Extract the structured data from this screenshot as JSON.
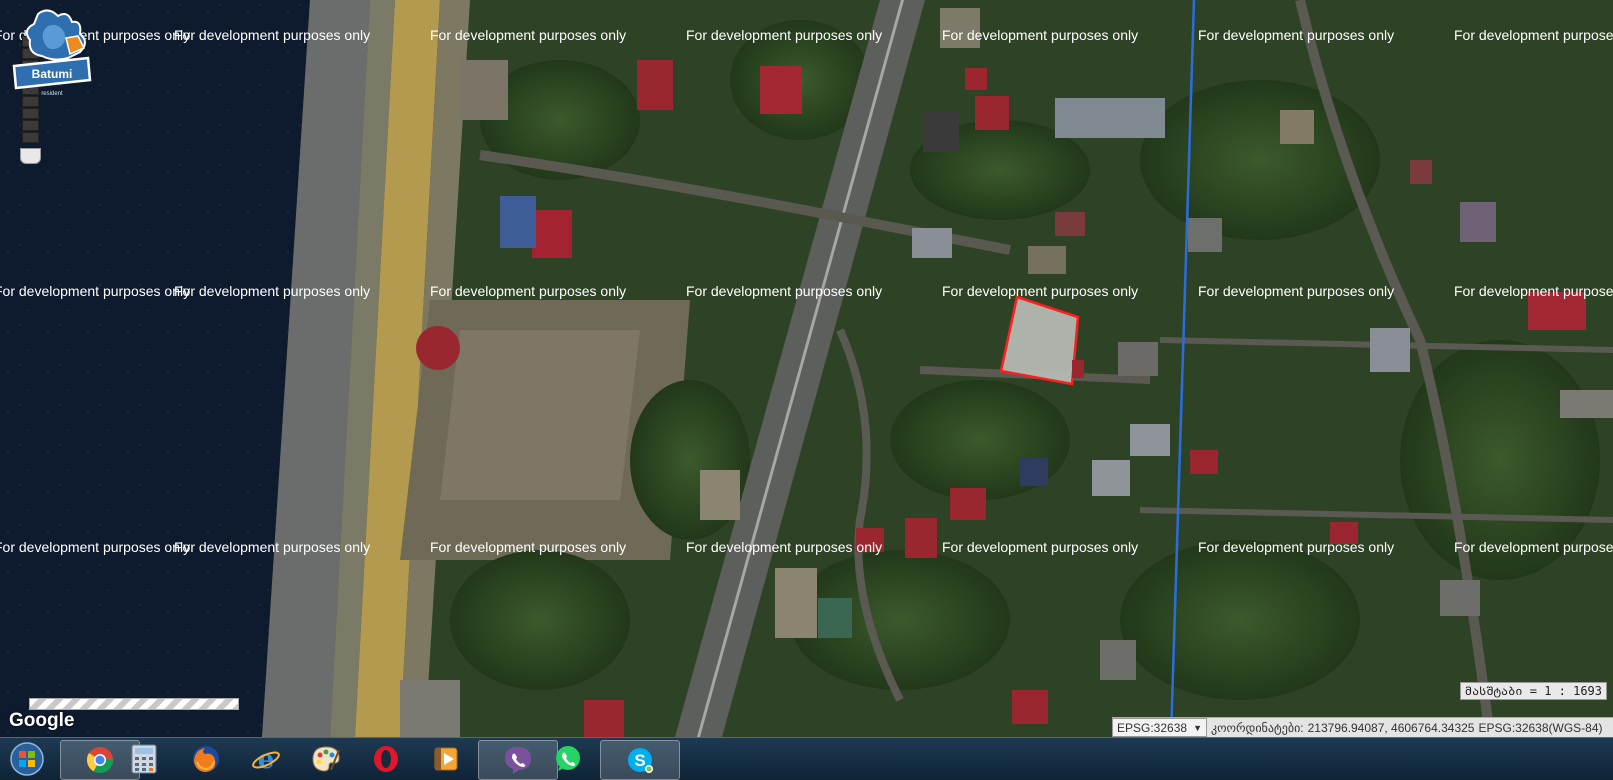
{
  "map": {
    "watermark": "For development purposes only",
    "attribution": "Google",
    "scale_text": "მასშტაბი = 1 : 1693"
  },
  "status": {
    "projection": "EPSG:32638",
    "coordinates_label": "კოორდინატები:",
    "coordinates_value": "213796.94087, 4606764.34325",
    "crs_wgs": "EPSG:32638(WGS-84)"
  },
  "logo": {
    "text": "Batumi",
    "subtext": "resident"
  },
  "taskbar": {
    "items": [
      {
        "name": "start-button",
        "icon": "windows-orb-icon"
      },
      {
        "name": "chrome",
        "icon": "chrome-icon"
      },
      {
        "name": "calculator",
        "icon": "calculator-icon"
      },
      {
        "name": "firefox",
        "icon": "firefox-icon"
      },
      {
        "name": "internet-explorer",
        "icon": "internet-explorer-icon"
      },
      {
        "name": "paint",
        "icon": "paint-palette-icon"
      },
      {
        "name": "opera",
        "icon": "opera-icon"
      },
      {
        "name": "media-player",
        "icon": "media-player-icon"
      },
      {
        "name": "viber",
        "icon": "viber-icon"
      },
      {
        "name": "whatsapp",
        "icon": "whatsapp-icon"
      },
      {
        "name": "skype",
        "icon": "skype-icon"
      }
    ]
  }
}
